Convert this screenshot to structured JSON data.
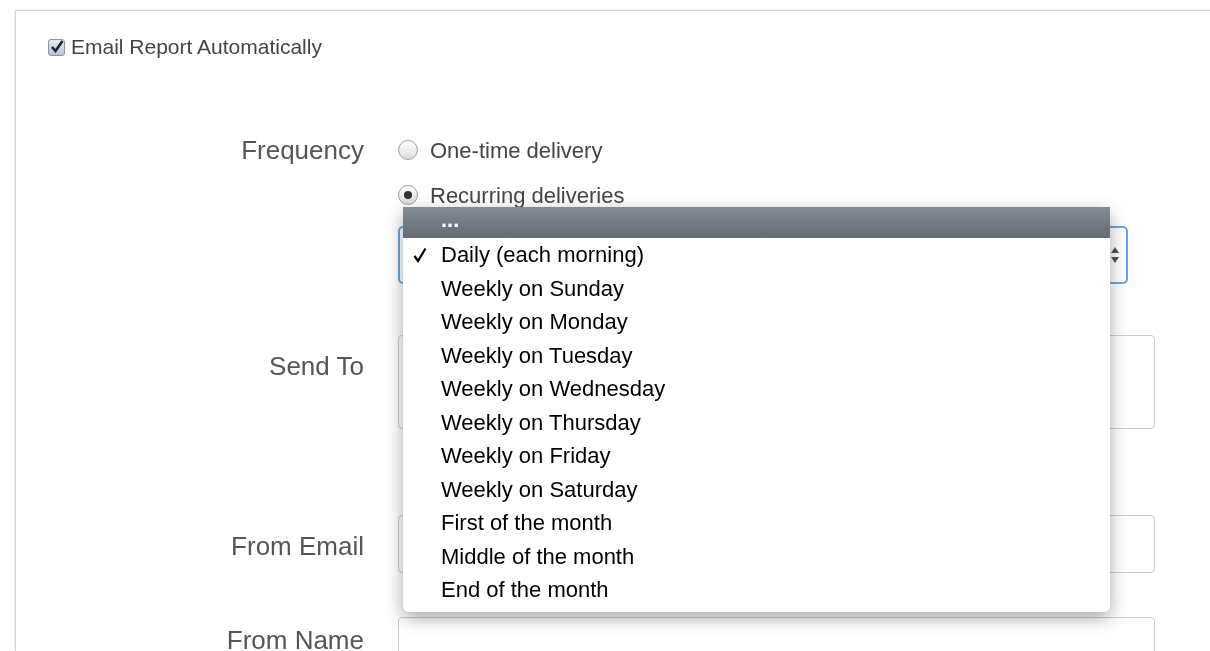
{
  "email_report": {
    "label": "Email Report Automatically",
    "checked": true
  },
  "frequency": {
    "label": "Frequency",
    "options": [
      {
        "label": "One-time delivery",
        "selected": false
      },
      {
        "label": "Recurring deliveries",
        "selected": true
      }
    ]
  },
  "send_to": {
    "label": "Send To"
  },
  "from_email": {
    "label": "From Email"
  },
  "from_name": {
    "label": "From Name"
  },
  "dropdown": {
    "header": "...",
    "items": [
      {
        "label": "Daily (each morning)",
        "selected": true
      },
      {
        "label": "Weekly on Sunday",
        "selected": false
      },
      {
        "label": "Weekly on Monday",
        "selected": false
      },
      {
        "label": "Weekly on Tuesday",
        "selected": false
      },
      {
        "label": "Weekly on Wednesday",
        "selected": false
      },
      {
        "label": "Weekly on Thursday",
        "selected": false
      },
      {
        "label": "Weekly on Friday",
        "selected": false
      },
      {
        "label": "Weekly on Saturday",
        "selected": false
      },
      {
        "label": "First of the month",
        "selected": false
      },
      {
        "label": "Middle of the month",
        "selected": false
      },
      {
        "label": "End of the month",
        "selected": false
      }
    ]
  }
}
